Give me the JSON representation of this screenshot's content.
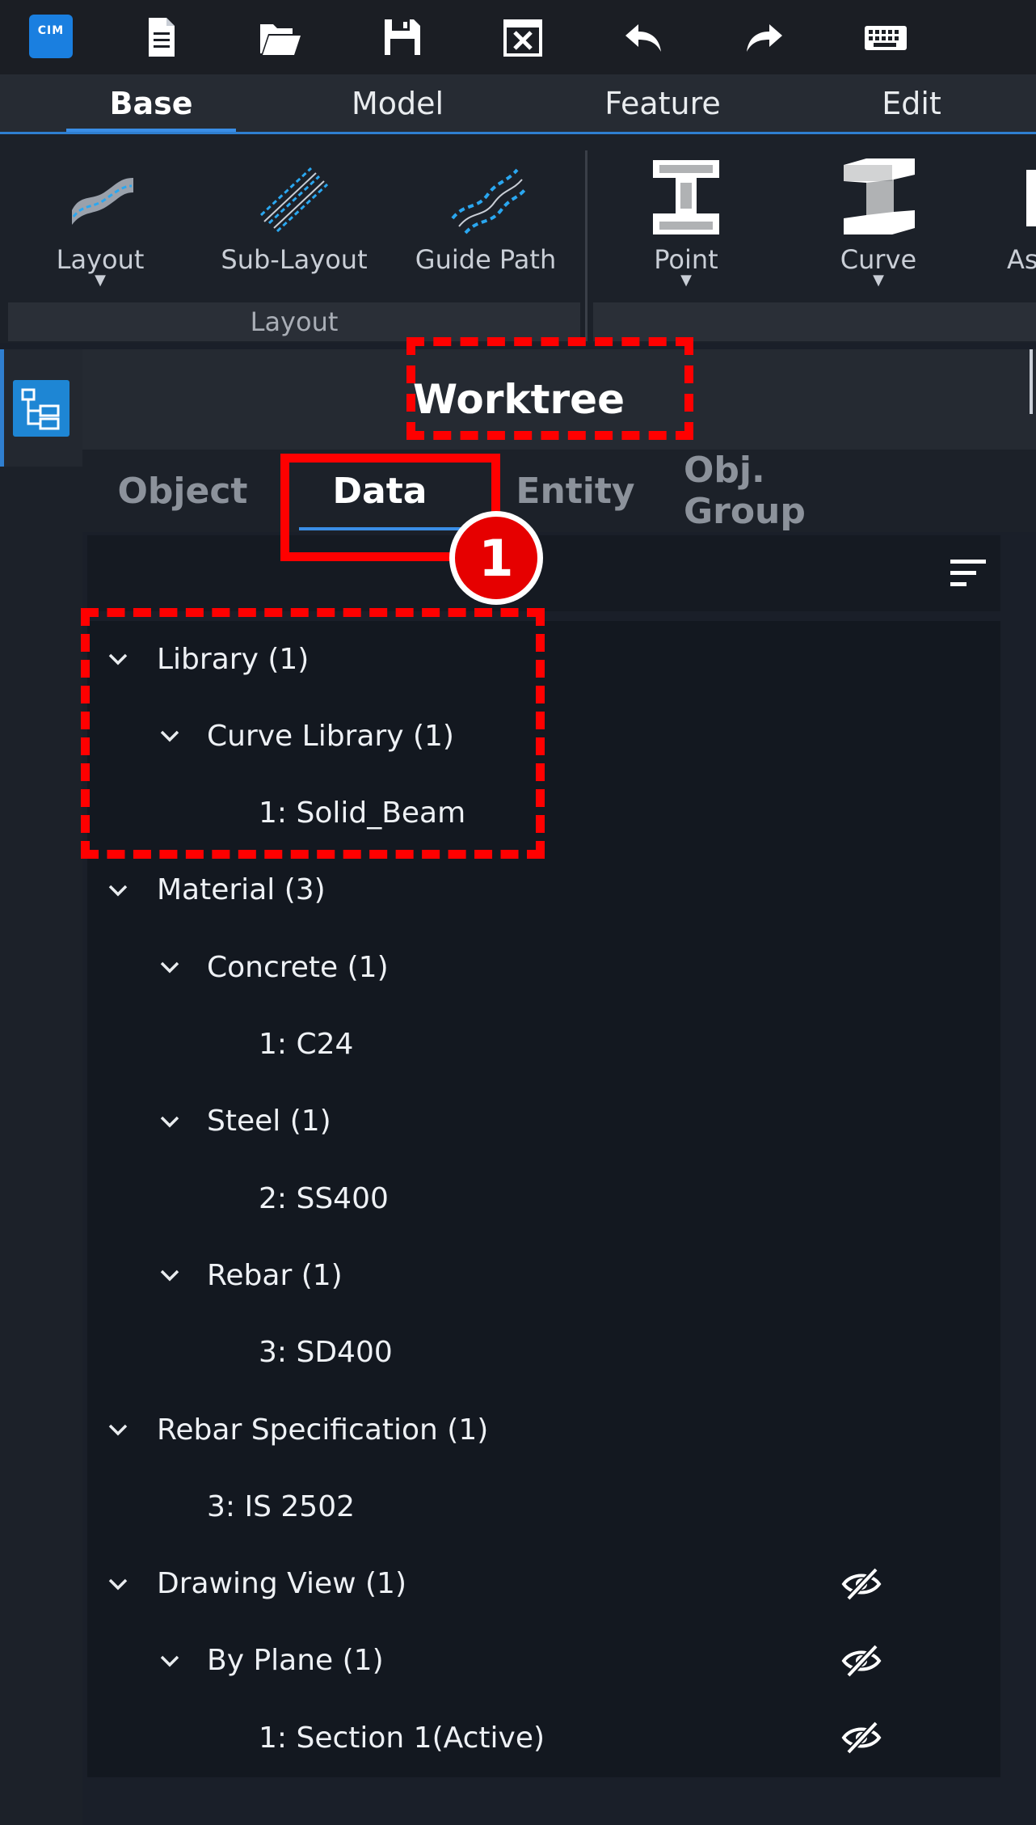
{
  "app": {
    "logo_text": "CIM"
  },
  "quick_access": [
    {
      "icon": "new-file-icon"
    },
    {
      "icon": "open-folder-icon"
    },
    {
      "icon": "save-icon"
    },
    {
      "icon": "close-window-icon"
    },
    {
      "icon": "undo-icon"
    },
    {
      "icon": "redo-icon"
    },
    {
      "icon": "keyboard-icon"
    }
  ],
  "menu_tabs": [
    {
      "label": "Base",
      "active": true
    },
    {
      "label": "Model"
    },
    {
      "label": "Feature"
    },
    {
      "label": "Edit"
    }
  ],
  "ribbon": {
    "layout_group": {
      "label": "Layout",
      "buttons": [
        {
          "label": "Layout",
          "has_dropdown": true,
          "icon": "layout-icon"
        },
        {
          "label": "Sub-Layout",
          "icon": "sub-layout-icon"
        },
        {
          "label": "Guide Path",
          "icon": "guide-path-icon"
        }
      ]
    },
    "section_group": {
      "buttons": [
        {
          "label": "Point",
          "has_dropdown": true,
          "icon": "point-section-icon"
        },
        {
          "label": "Curve",
          "has_dropdown": true,
          "icon": "curve-section-icon"
        },
        {
          "label": "As",
          "icon": "assembly-icon"
        }
      ]
    }
  },
  "worktree": {
    "title": "Worktree",
    "tabs": [
      {
        "label": "Object"
      },
      {
        "label": "Data",
        "active": true
      },
      {
        "label": "Entity"
      },
      {
        "label": "Obj. Group"
      }
    ],
    "tree": [
      {
        "label": "Library (1)",
        "level": 0,
        "expanded": true
      },
      {
        "label": "Curve Library (1)",
        "level": 1,
        "expanded": true
      },
      {
        "label": "1: Solid_Beam",
        "level": 2
      },
      {
        "label": "Material (3)",
        "level": 0,
        "expanded": true
      },
      {
        "label": "Concrete (1)",
        "level": 1,
        "expanded": true
      },
      {
        "label": "1: C24",
        "level": 2
      },
      {
        "label": "Steel (1)",
        "level": 1,
        "expanded": true
      },
      {
        "label": "2: SS400",
        "level": 2
      },
      {
        "label": "Rebar (1)",
        "level": 1,
        "expanded": true
      },
      {
        "label": "3: SD400",
        "level": 2
      },
      {
        "label": "Rebar Specification (1)",
        "level": 0,
        "expanded": true
      },
      {
        "label": "3: IS 2502",
        "level": 1
      },
      {
        "label": "Drawing View (1)",
        "level": 0,
        "expanded": true,
        "visibility": "hidden"
      },
      {
        "label": "By Plane (1)",
        "level": 1,
        "expanded": true,
        "visibility": "hidden"
      },
      {
        "label": "1: Section 1(Active)",
        "level": 2,
        "visibility": "hidden"
      }
    ]
  },
  "annotation": {
    "badge": "1"
  },
  "colors": {
    "accent": "#2f7fd0",
    "annotation": "#ff0000",
    "panel": "#131820"
  }
}
